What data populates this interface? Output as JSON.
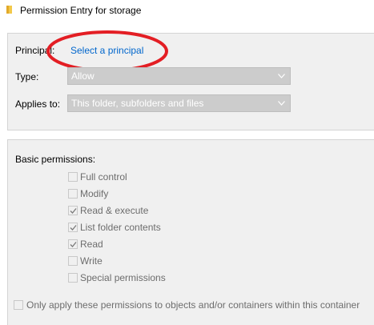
{
  "window": {
    "title": "Permission Entry for storage"
  },
  "principal": {
    "label": "Principal:",
    "link": "Select a principal"
  },
  "type": {
    "label": "Type:",
    "value": "Allow"
  },
  "applies_to": {
    "label": "Applies to:",
    "value": "This folder, subfolders and files"
  },
  "basic_permissions": {
    "heading": "Basic permissions:",
    "items": [
      {
        "label": "Full control",
        "checked": false
      },
      {
        "label": "Modify",
        "checked": false
      },
      {
        "label": "Read & execute",
        "checked": true
      },
      {
        "label": "List folder contents",
        "checked": true
      },
      {
        "label": "Read",
        "checked": true
      },
      {
        "label": "Write",
        "checked": false
      },
      {
        "label": "Special permissions",
        "checked": false
      }
    ]
  },
  "only_apply": {
    "label": "Only apply these permissions to objects and/or containers within this container",
    "checked": false
  },
  "colors": {
    "link": "#0066cc",
    "annotation": "#e31e24",
    "disabled_combo": "#cccccc"
  }
}
